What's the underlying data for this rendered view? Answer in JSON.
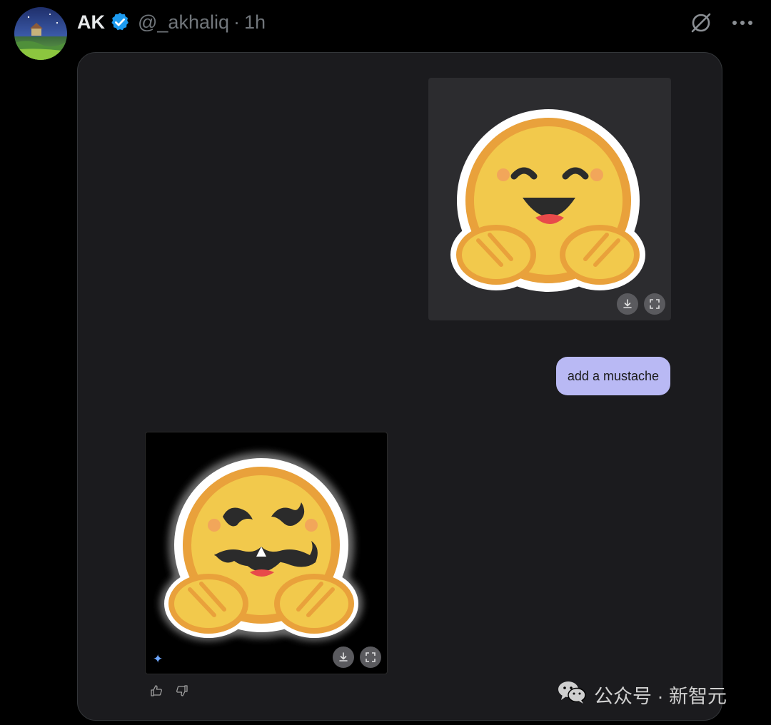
{
  "tweet": {
    "display_name": "AK",
    "handle": "@_akhaliq",
    "separator": "·",
    "time": "1h"
  },
  "icons": {
    "verified": "verified-badge-icon",
    "grok": "grok-icon",
    "more": "more-options-icon",
    "download": "download-icon",
    "fullscreen": "fullscreen-icon",
    "sparkle": "sparkle-icon",
    "thumbs_up": "thumbs-up-icon",
    "thumbs_down": "thumbs-down-icon",
    "wechat": "wechat-icon"
  },
  "chat": {
    "user_message": "add a mustache",
    "sparkle_glyph": "✦"
  },
  "watermark": {
    "text": "公众号 · 新智元"
  },
  "colors": {
    "background": "#000000",
    "card": "#1b1b1e",
    "bubble": "#b9b9f4",
    "verified": "#1d9bf0",
    "emoji_yellow": "#f2c94c",
    "emoji_orange": "#e9a13b"
  }
}
